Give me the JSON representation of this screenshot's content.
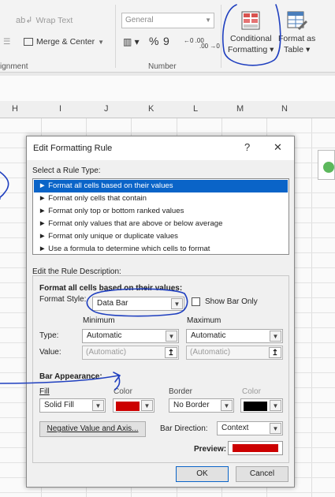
{
  "ribbon": {
    "wrap_text": "Wrap Text",
    "merge_center": "Merge & Center",
    "alignment_group": "ignment",
    "number_format": "General",
    "percent": "%",
    "comma": "9",
    "decimals_inc": "←0 .00",
    "decimals_dec": ".00 →0",
    "number_group": "Number",
    "conditional_formatting": [
      "Conditional",
      "Formatting ▾"
    ],
    "format_as_table": [
      "Format as",
      "Table ▾"
    ]
  },
  "columns": [
    "H",
    "I",
    "J",
    "K",
    "L",
    "M",
    "N"
  ],
  "dialog": {
    "title": "Edit Formatting Rule",
    "help": "?",
    "close": "✕",
    "select_rule_type": "Select a Rule Type:",
    "rule_types": [
      "► Format all cells based on their values",
      "► Format only cells that contain",
      "► Format only top or bottom ranked values",
      "► Format only values that are above or below average",
      "► Format only unique or duplicate values",
      "► Use a formula to determine which cells to format"
    ],
    "edit_rule_description": "Edit the Rule Description:",
    "format_all_header": "Format all cells based on their values:",
    "format_style_label": "Format Style:",
    "format_style_value": "Data Bar",
    "show_bar_only": "Show Bar Only",
    "minimum": "Minimum",
    "maximum": "Maximum",
    "type_label": "Type:",
    "value_label": "Value:",
    "min_type": "Automatic",
    "max_type": "Automatic",
    "min_value": "(Automatic)",
    "max_value": "(Automatic)",
    "bar_appearance": "Bar Appearance:",
    "fill_label": "Fill",
    "color_label": "Color",
    "border_label": "Border",
    "border_color_label": "Color",
    "fill_value": "Solid Fill",
    "border_value": "No Border",
    "fill_color": "#cc0000",
    "border_color": "#000000",
    "negative_button": "Negative Value and Axis...",
    "bar_direction_label": "Bar Direction:",
    "bar_direction_value": "Context",
    "preview_label": "Preview:",
    "preview_color": "#cc0000",
    "ok": "OK",
    "cancel": "Cancel"
  },
  "colors": {
    "selection": "#0a64c8",
    "ink": "#1f3fbf"
  }
}
